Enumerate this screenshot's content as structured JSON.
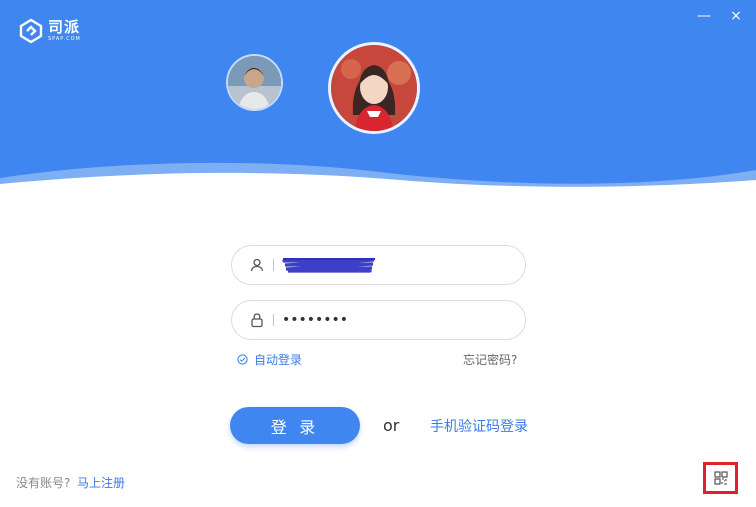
{
  "brand": {
    "name": "司派",
    "domain": "SPAP.COM"
  },
  "window": {
    "minimize_glyph": "—",
    "close_glyph": "×"
  },
  "accounts": [
    {
      "avatar_icon": "user-avatar-photo"
    },
    {
      "avatar_icon": "user-avatar-photo"
    }
  ],
  "form": {
    "username_value": "",
    "password_value": "••••••••",
    "auto_login_label": "自动登录",
    "forgot_password": "忘记密码?",
    "login_button": "登 录",
    "or_text": "or",
    "sms_login": "手机验证码登录"
  },
  "footer": {
    "no_account": "没有账号?",
    "register_link": "马上注册"
  },
  "icons": {
    "user": "user-icon",
    "lock": "lock-icon",
    "check": "check-circle-icon",
    "qr": "qr-code-icon"
  },
  "colors": {
    "primary": "#3f86f0",
    "link": "#3a7be8",
    "highlight": "#e0202a"
  }
}
